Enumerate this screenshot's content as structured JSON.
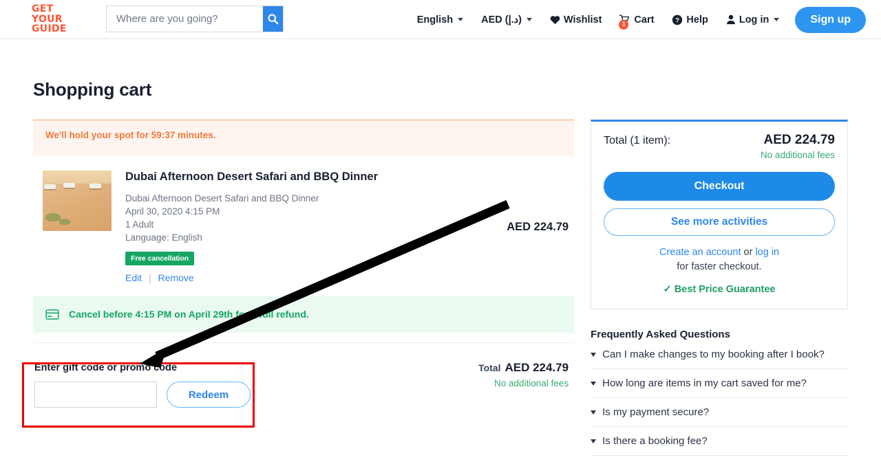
{
  "header": {
    "logo_lines": [
      "GET",
      "YOUR",
      "GUIDE"
    ],
    "logo_color": "#ff5533",
    "search": {
      "placeholder": "Where are you going?",
      "value": "",
      "icon": "search-icon",
      "button_color": "#2e87e8"
    },
    "nav": {
      "language": "English",
      "currency": "AED (د.إ)",
      "wishlist": "Wishlist",
      "cart": "Cart",
      "cart_count": "1",
      "help": "Help",
      "login": "Log in",
      "signup": "Sign up"
    }
  },
  "main": {
    "page_title": "Shopping cart",
    "timer_banner": "We'll hold your spot for 59:37 minutes.",
    "item": {
      "title": "Dubai Afternoon Desert Safari and BBQ Dinner",
      "option": "Dubai Afternoon Desert Safari and BBQ Dinner",
      "datetime": "April 30, 2020 4:15 PM",
      "travelers": "1 Adult",
      "language": "Language: English",
      "badge": "Free cancellation",
      "edit": "Edit",
      "remove": "Remove",
      "price": "AED 224.79",
      "thumbnail_alt": "desert-safari-photo"
    },
    "cancel_banner": {
      "icon": "credit-card-icon",
      "text": "Cancel before 4:15 PM on April 29th for a full refund."
    },
    "promo": {
      "label": "Enter gift code or promo code",
      "input_value": "",
      "input_placeholder": "",
      "redeem_button": "Redeem"
    },
    "totals": {
      "label": "Total",
      "amount": "AED 224.79",
      "fees_note": "No additional fees"
    }
  },
  "sidebar": {
    "summary": {
      "total_label": "Total (1 item):",
      "total_amount": "AED 224.79",
      "fees_note": "No additional fees",
      "checkout_button": "Checkout",
      "more_activities_button": "See more activities",
      "create_account_link": "Create an account",
      "or_text": " or ",
      "login_link": "log in",
      "faster_checkout_text": "for faster checkout.",
      "guarantee": "Best Price Guarantee"
    },
    "faq": {
      "title": "Frequently Asked Questions",
      "items": [
        "Can I make changes to my booking after I book?",
        "How long are items in my cart saved for me?",
        "Is my payment secure?",
        "Is there a booking fee?"
      ]
    }
  },
  "annotations": {
    "highlight_color": "#ee0000",
    "arrow_color": "#000000",
    "arrow_from": "740,296",
    "arrow_to": "207,527"
  }
}
